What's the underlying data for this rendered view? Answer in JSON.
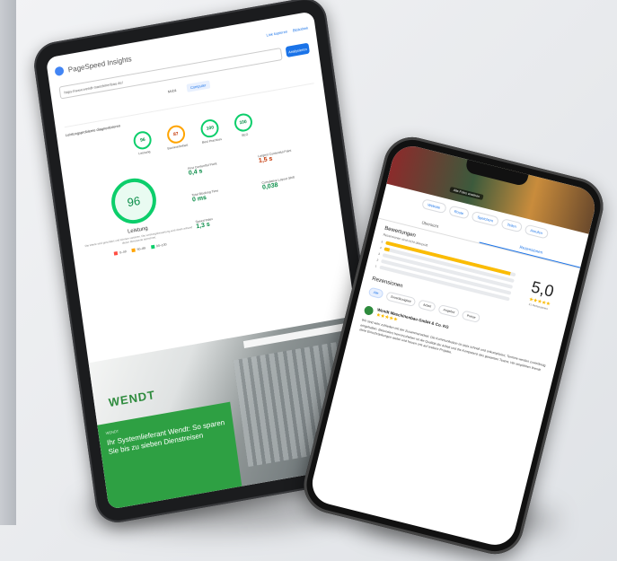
{
  "tablet": {
    "app_title": "PageSpeed Insights",
    "top_links": [
      "Link kopieren",
      "Bibliothek"
    ],
    "url_value": "https://www.wendt-maschinenbau.de/",
    "analyze_label": "Analysieren",
    "device_tabs": [
      "Mobil",
      "Computer"
    ],
    "diagnostics_heading": "Leistungsprobleme diagnostizieren",
    "gauges": [
      {
        "score": "96",
        "label": "Leistung"
      },
      {
        "score": "87",
        "label": "Barrierefreiheit"
      },
      {
        "score": "100",
        "label": "Best Practices"
      },
      {
        "score": "100",
        "label": "SEO"
      }
    ],
    "big_score": "96",
    "big_label": "Leistung",
    "note": "Die Werte sind geschätzt und können variieren. Die Leistungsbewertung wird direkt anhand dieser Messwerte berechnet.",
    "legend": [
      "0–49",
      "50–89",
      "90–100"
    ],
    "metrics_heading": "MESSWERTE",
    "metrics": [
      {
        "label": "First Contentful Paint",
        "value": "0,4 s",
        "status": "good"
      },
      {
        "label": "Largest Contentful Paint",
        "value": "1,5 s",
        "status": "avg"
      },
      {
        "label": "Total Blocking Time",
        "value": "0 ms",
        "status": "good"
      },
      {
        "label": "Cumulative Layout Shift",
        "value": "0,038",
        "status": "good"
      },
      {
        "label": "Speed Index",
        "value": "1,3 s",
        "status": "good"
      }
    ],
    "site_logo": "WENDT",
    "site_tag": "WENDT",
    "site_headline": "Ihr Systemlieferant Wendt: So sparen Sie bis zu sieben Dienstreisen"
  },
  "phone": {
    "hero_chip": "Alle Fotos ansehen",
    "actions": [
      "Website",
      "Route",
      "Speichern",
      "Teilen",
      "Anrufen"
    ],
    "tabs": [
      "Übersicht",
      "Rezensionen"
    ],
    "reviews_heading": "Bewertungen",
    "reviews_subtitle": "Rezensionen sind nicht überprüft",
    "rating_bars": [
      {
        "stars": "5",
        "fill": 0.96
      },
      {
        "stars": "4",
        "fill": 0.04
      },
      {
        "stars": "3",
        "fill": 0
      },
      {
        "stars": "2",
        "fill": 0
      },
      {
        "stars": "1",
        "fill": 0
      }
    ],
    "score": "5,0",
    "stars": "★★★★★",
    "review_count": "41 Rezensionen",
    "filter_heading": "Rezensionen",
    "filter_chips": [
      "Alle",
      "Zuverlässigkeit",
      "Arbeit",
      "Angebot",
      "Preise"
    ],
    "review_name": "Wendt Maschinenbau GmbH & Co. KG",
    "review_stars": "★★★★★",
    "review_text": "Wir sind sehr zufrieden mit der Zusammenarbeit. Die Kommunikation ist stets schnell und unkompliziert, Termine werden zuverlässig eingehalten. Besonders hervorzuheben ist die Qualität der Arbeit und die Kompetenz des gesamten Teams. Wir empfehlen Wendt ohne Einschränkungen weiter und freuen uns auf weitere Projekte."
  },
  "colors": {
    "green": "#2ea043",
    "blue": "#1a73e8",
    "star": "#fbbc04"
  }
}
